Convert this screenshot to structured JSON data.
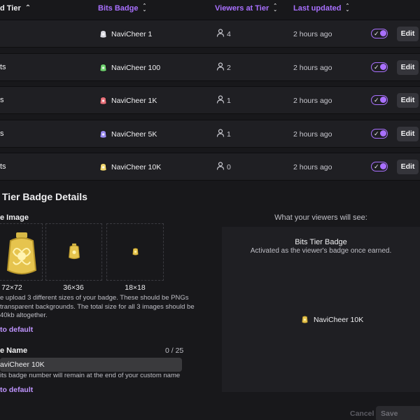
{
  "table": {
    "headers": {
      "tier": "d Tier",
      "badge": "Bits Badge",
      "viewers": "Viewers at Tier",
      "updated": "Last updated"
    },
    "rows": [
      {
        "tier": "",
        "badge_name": "NaviCheer 1",
        "viewers": "4",
        "updated": "2 hours ago",
        "badge_color": "#d8d8e0",
        "enabled": true,
        "edit_label": "Edit"
      },
      {
        "tier": "ts",
        "badge_name": "NaviCheer 100",
        "viewers": "2",
        "updated": "2 hours ago",
        "badge_color": "#6fd16f",
        "enabled": true,
        "edit_label": "Edit"
      },
      {
        "tier": "s",
        "badge_name": "NaviCheer 1K",
        "viewers": "1",
        "updated": "2 hours ago",
        "badge_color": "#e8707a",
        "enabled": true,
        "edit_label": "Edit"
      },
      {
        "tier": "s",
        "badge_name": "NaviCheer 5K",
        "viewers": "1",
        "updated": "2 hours ago",
        "badge_color": "#9b8cf0",
        "enabled": true,
        "edit_label": "Edit"
      },
      {
        "tier": "ts",
        "badge_name": "NaviCheer 10K",
        "viewers": "0",
        "updated": "2 hours ago",
        "badge_color": "#f0d770",
        "enabled": true,
        "edit_label": "Edit"
      }
    ]
  },
  "details": {
    "title": "Tier Badge Details",
    "image_label": "e Image",
    "sizes": [
      "72×72",
      "36×36",
      "18×18"
    ],
    "help_lines": [
      "e upload 3 different sizes of your badge. These should be PNGs",
      "transparent backgrounds. The total size for all 3 images should be",
      "40kb altogether."
    ],
    "reset_image_link": "to default",
    "name_label": "e Name",
    "name_counter": "0 / 25",
    "name_value": "aviCheer 10K",
    "name_help": "its badge number will remain at the end of your custom name",
    "reset_name_link": "to default"
  },
  "preview": {
    "heading": "What your viewers will see:",
    "title": "Bits Tier Badge",
    "subtitle": "Activated as the viewer's badge once earned.",
    "badge_name": "NaviCheer 10K"
  },
  "footer": {
    "cancel": "Cancel",
    "save": "Save Change"
  },
  "colors": {
    "accent": "#a970ff",
    "link": "#bf94ff",
    "background": "#18181b",
    "row_bg": "#1f1f23"
  }
}
